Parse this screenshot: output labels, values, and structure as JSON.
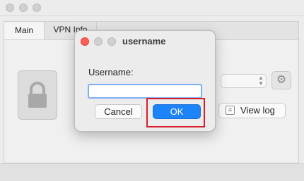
{
  "window": {
    "tabs": [
      {
        "label": "Main"
      },
      {
        "label": "VPN Info"
      }
    ],
    "view_log_label": "View log"
  },
  "dialog": {
    "title": "username",
    "field_label": "Username:",
    "field_value": "",
    "cancel_label": "Cancel",
    "ok_label": "OK"
  },
  "colors": {
    "accent": "#1d83f8",
    "highlight": "#d5202a",
    "close": "#ff5f57"
  }
}
